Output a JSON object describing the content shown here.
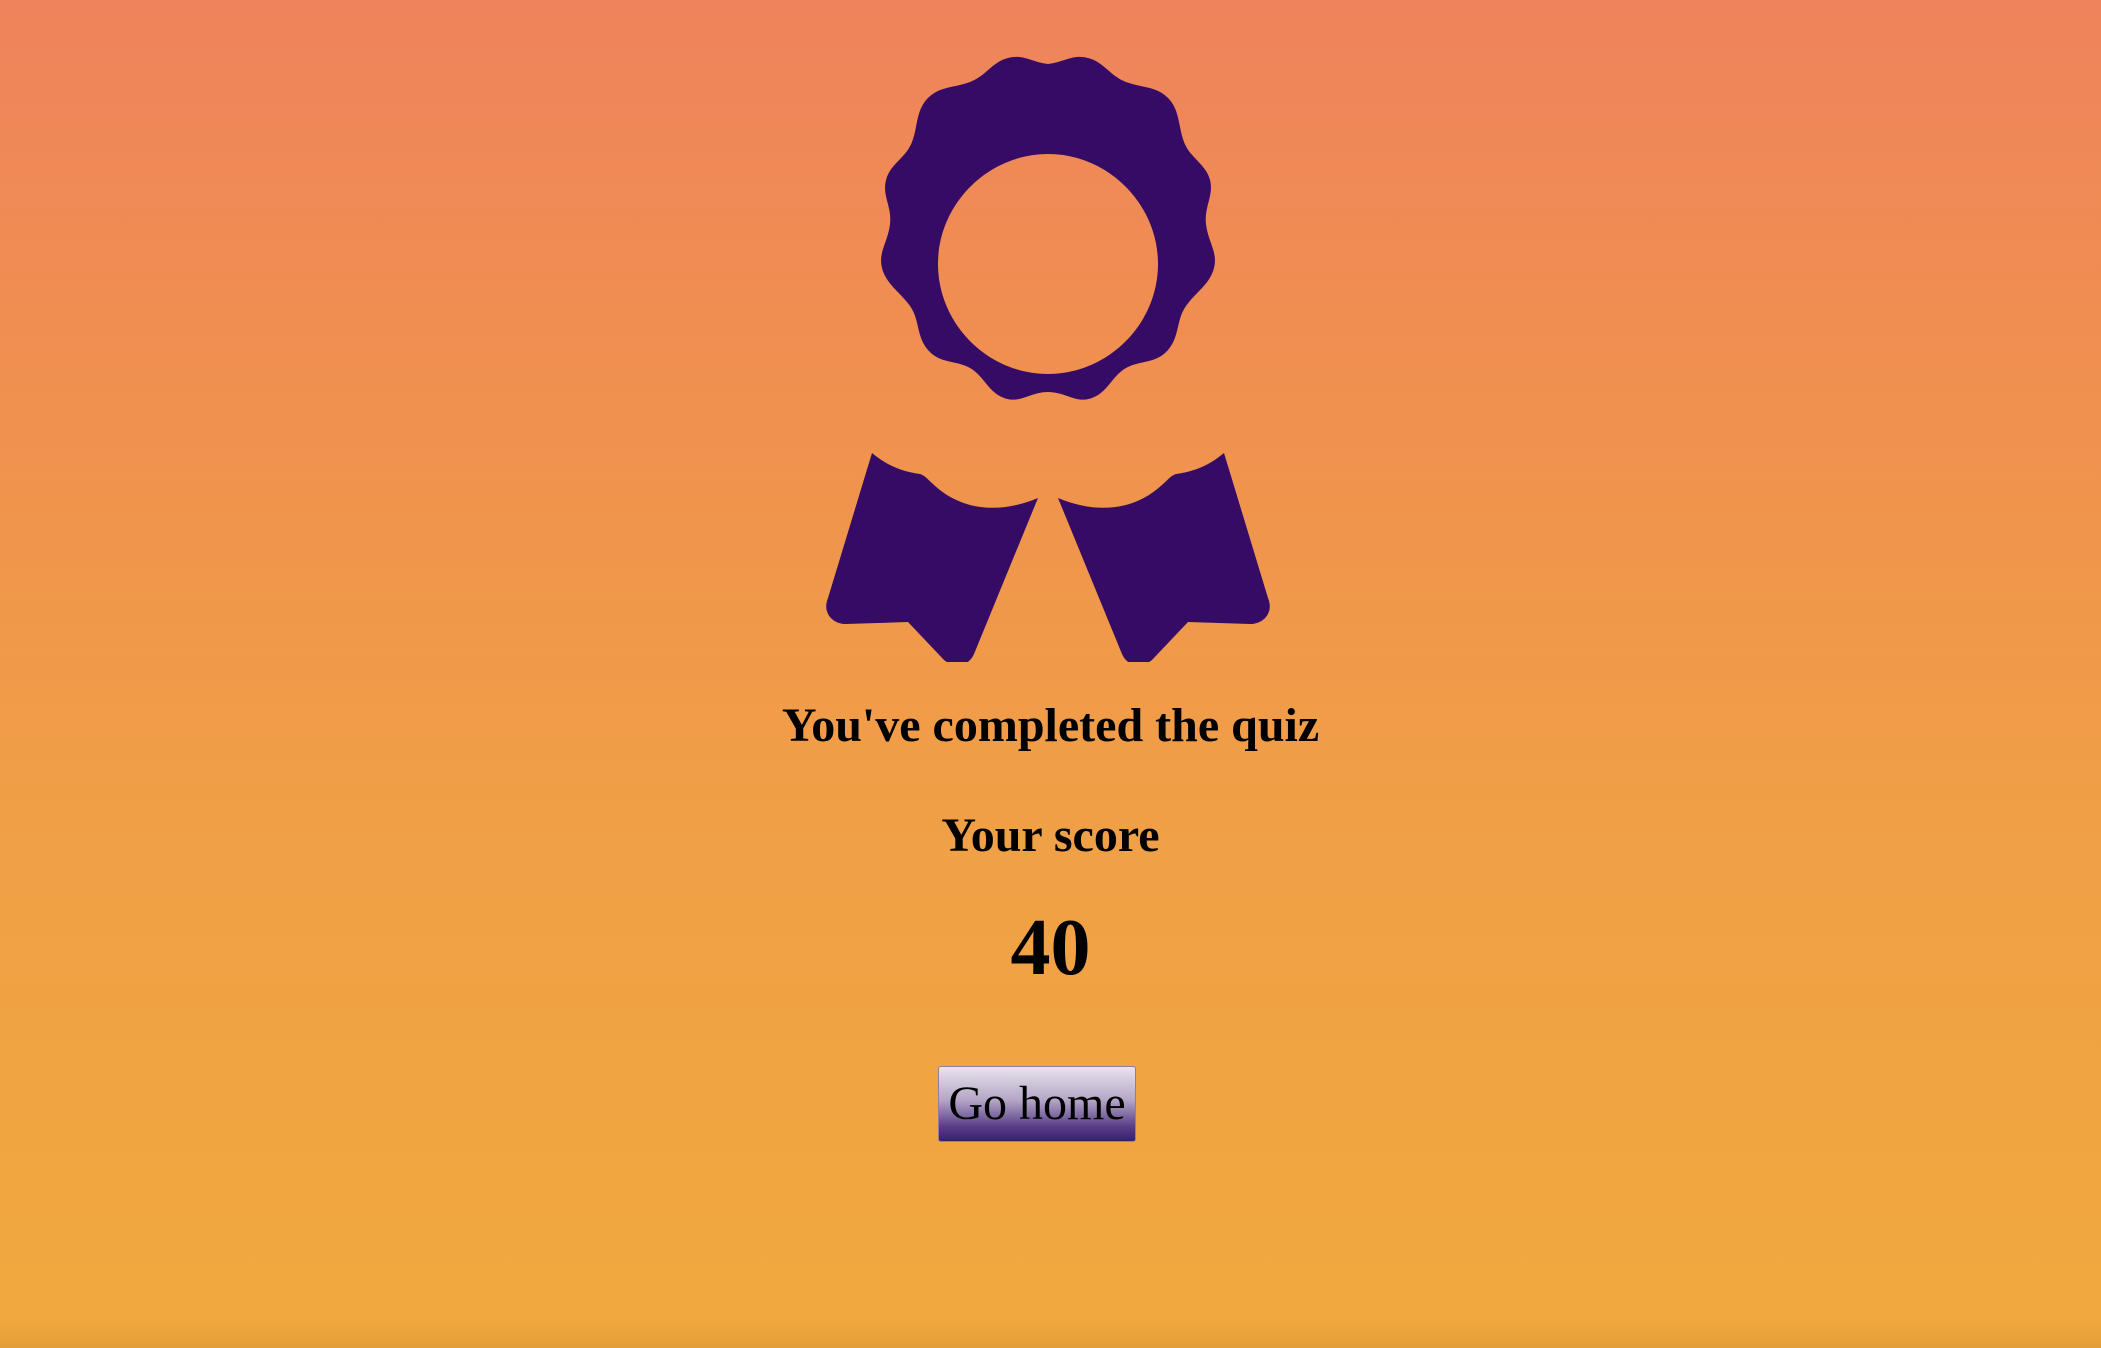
{
  "quiz_result": {
    "badge_icon": "award-ribbon-icon",
    "badge_color": "#350b65",
    "completed_title": "You've completed the quiz",
    "score_label": "Your score",
    "score_value": "40",
    "home_button_label": "Go home"
  },
  "theme": {
    "background_top": "#ef835c",
    "background_bottom": "#f1a93e",
    "button_gradient_top": "#e9e4ee",
    "button_gradient_bottom": "#3b1d6e"
  }
}
